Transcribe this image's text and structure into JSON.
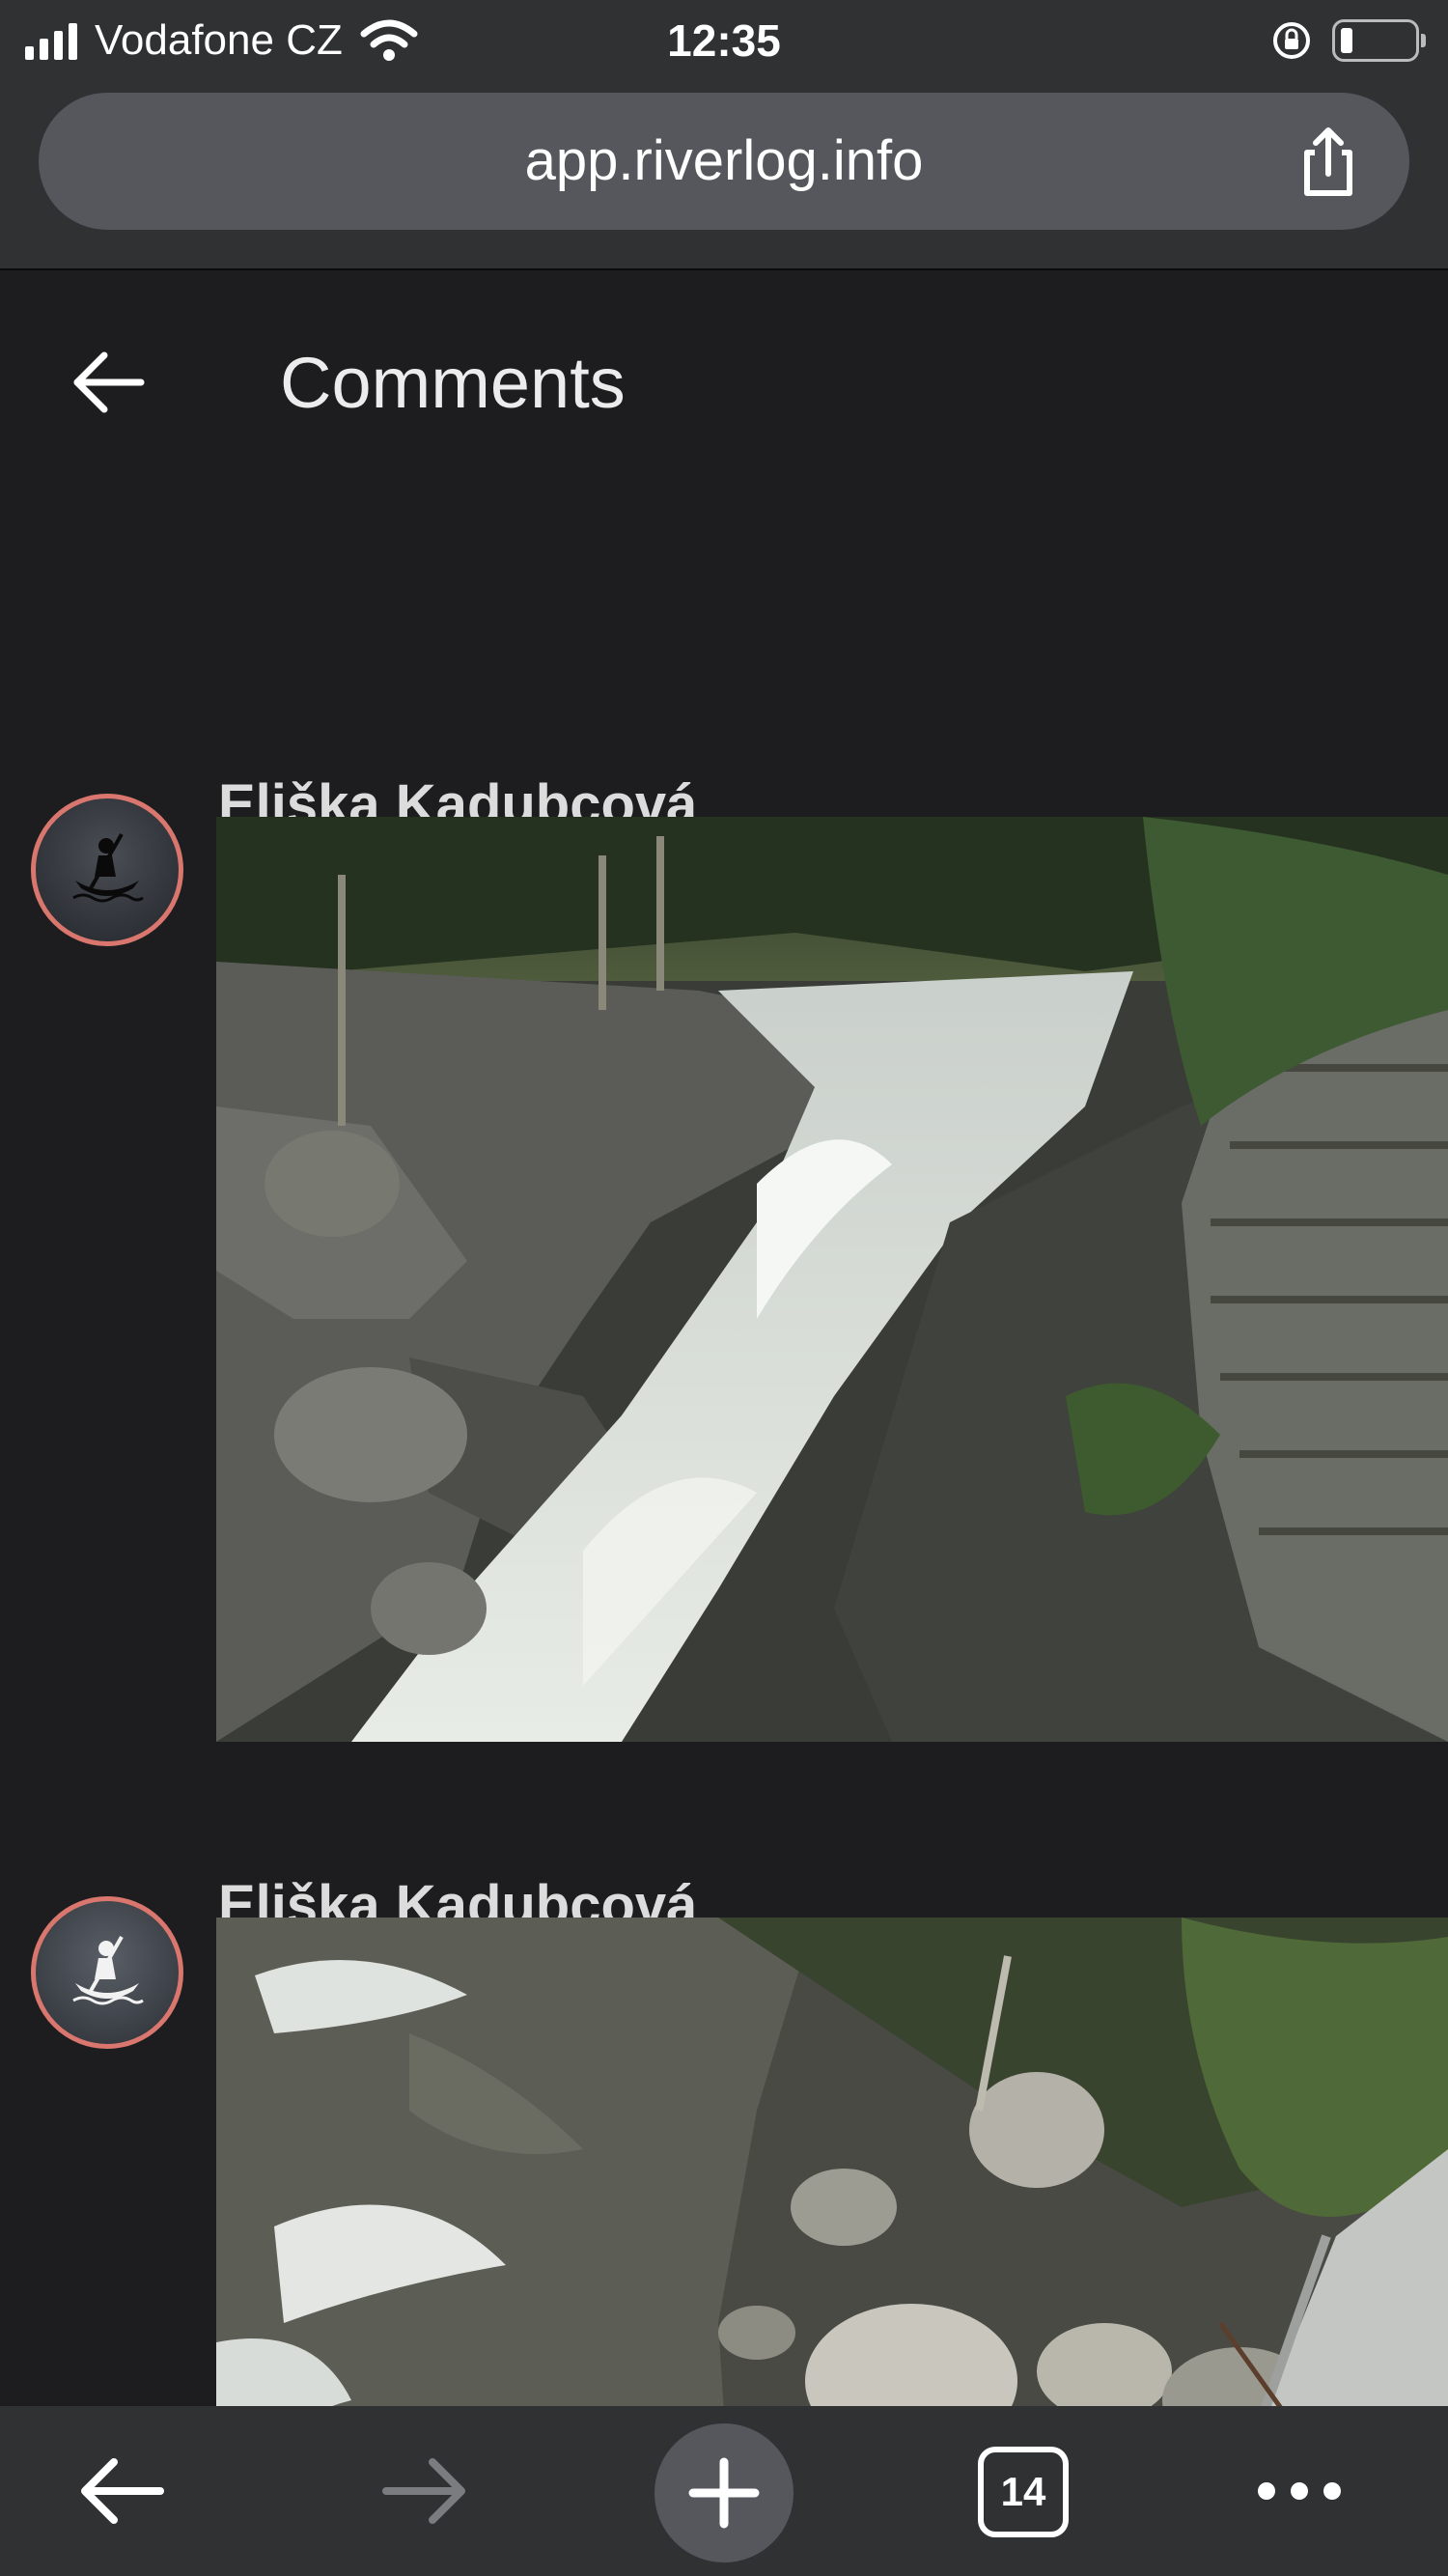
{
  "status_bar": {
    "carrier": "Vodafone CZ",
    "time": "12:35"
  },
  "browser": {
    "url": "app.riverlog.info",
    "tab_count": "14"
  },
  "page": {
    "title": "Comments",
    "comments": [
      {
        "author": "Eliška Kadubcová",
        "avatar_icon": "kayaker-icon",
        "photo": "river-rapids-photo"
      },
      {
        "author": "Eliška Kadubcová",
        "avatar_icon": "kayaker-icon",
        "photo": "river-rocks-photo"
      }
    ]
  },
  "colors": {
    "background": "#1d1d1f",
    "bar": "#303133",
    "avatar_ring": "#d9776e"
  }
}
